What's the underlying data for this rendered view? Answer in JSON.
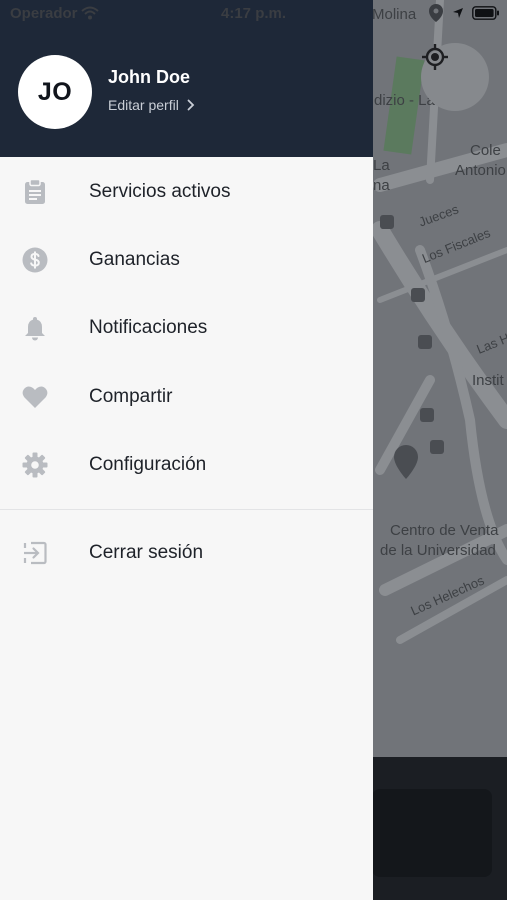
{
  "status_bar": {
    "carrier": "Operador",
    "time": "4:17 p.m."
  },
  "map": {
    "labels": {
      "molina": "Molina",
      "edificio": "dizio - La",
      "colegio": "Cole",
      "antonio": "Antonio",
      "la": "La",
      "na": "na",
      "jueces": "Jueces",
      "fiscales": "Los Fiscales",
      "las": "Las H",
      "instit": "Instit",
      "centro_line1": "Centro de Venta",
      "centro_line2": "de la Universidad",
      "helechos": "Los Helechos"
    }
  },
  "drawer": {
    "avatar_initials": "JO",
    "user_name": "John Doe",
    "edit_profile": "Editar perfil",
    "menu": [
      {
        "label": "Servicios activos",
        "icon": "clipboard-icon"
      },
      {
        "label": "Ganancias",
        "icon": "dollar-icon"
      },
      {
        "label": "Notificaciones",
        "icon": "bell-icon"
      },
      {
        "label": "Compartir",
        "icon": "heart-icon"
      },
      {
        "label": "Configuración",
        "icon": "gear-icon"
      }
    ],
    "logout": {
      "label": "Cerrar sesión",
      "icon": "logout-icon"
    }
  },
  "colors": {
    "header_bg": "#1e2838",
    "drawer_bg": "#f7f7f7",
    "icon_gray": "#b9bcc1",
    "map_dim": "#717479"
  }
}
